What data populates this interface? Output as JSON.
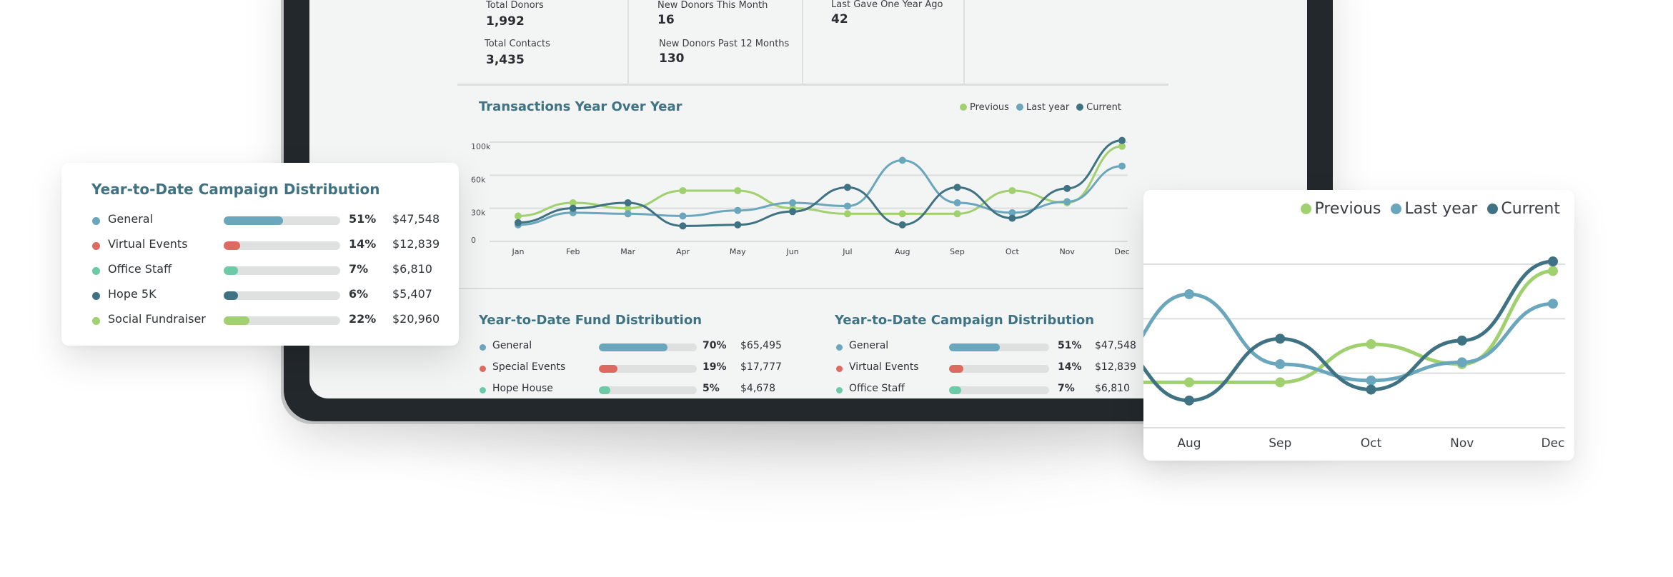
{
  "stats": {
    "total_donors": {
      "label": "Total Donors",
      "value": "1,992"
    },
    "total_contacts": {
      "label": "Total Contacts",
      "value": "3,435"
    },
    "new_donors_month": {
      "label": "New Donors This Month",
      "value": "16"
    },
    "new_donors_12m": {
      "label": "New Donors Past 12 Months",
      "value": "130"
    },
    "last_gave_one_year": {
      "label": "Last Gave One Year Ago",
      "value": "42"
    }
  },
  "colors": {
    "previous": "#a0d16e",
    "last_year": "#6aa6bc",
    "current": "#3f7282",
    "title": "#3f7384",
    "general": "#6aa6bc",
    "events": "#dc6a60",
    "office": "#6ccaa6",
    "hope5k": "#3f7282",
    "social": "#a0d16e"
  },
  "chart_data": [
    {
      "type": "line",
      "title": "Transactions Year Over Year",
      "xlabel": "",
      "ylabel": "",
      "y_ticks": [
        "0",
        "30k",
        "60k",
        "100k"
      ],
      "y_tick_values": [
        0,
        30,
        60,
        100
      ],
      "y_unit": "k",
      "grid": true,
      "legend": "top-right",
      "categories": [
        "Jan",
        "Feb",
        "Mar",
        "Apr",
        "May",
        "Jun",
        "Jul",
        "Aug",
        "Sep",
        "Oct",
        "Nov",
        "Dec"
      ],
      "series": [
        {
          "name": "Previous",
          "key": "previous",
          "values": [
            23,
            35,
            30,
            46,
            46,
            30,
            25,
            25,
            25,
            46,
            35,
            95
          ]
        },
        {
          "name": "Last year",
          "key": "last_year",
          "values": [
            15,
            26,
            25,
            23,
            28,
            35,
            32,
            78,
            35,
            26,
            36,
            71
          ]
        },
        {
          "name": "Current",
          "key": "current",
          "values": [
            17,
            30,
            35,
            14,
            15,
            27,
            49,
            15,
            49,
            21,
            48,
            102
          ]
        }
      ]
    },
    {
      "type": "line",
      "title": "",
      "xlabel": "",
      "ylabel": "",
      "grid": true,
      "legend": "top-right",
      "y_tick_values": [
        0,
        30,
        60,
        100
      ],
      "categories": [
        "Aug",
        "Sep",
        "Oct",
        "Nov",
        "Dec"
      ],
      "series": [
        {
          "name": "Previous",
          "key": "previous",
          "values": [
            25,
            25,
            46,
            35,
            95
          ]
        },
        {
          "name": "Last year",
          "key": "last_year",
          "values": [
            78,
            35,
            26,
            36,
            71
          ]
        },
        {
          "name": "Current",
          "key": "current",
          "values": [
            15,
            49,
            21,
            48,
            102
          ]
        }
      ]
    }
  ],
  "fund_distribution": {
    "title": "Year-to-Date Fund Distribution",
    "rows": [
      {
        "label": "General",
        "percent": 70,
        "percent_label": "70%",
        "amount": "$65,495",
        "color": "#6aa6bc"
      },
      {
        "label": "Special Events",
        "percent": 19,
        "percent_label": "19%",
        "amount": "$17,777",
        "color": "#dc6a60"
      },
      {
        "label": "Hope House",
        "percent": 5,
        "percent_label": "5%",
        "amount": "$4,678",
        "color": "#6ccaa6"
      }
    ]
  },
  "campaign_distribution": {
    "title": "Year-to-Date Campaign Distribution",
    "rows": [
      {
        "label": "General",
        "percent": 51,
        "percent_label": "51%",
        "amount": "$47,548",
        "color": "#6aa6bc"
      },
      {
        "label": "Virtual Events",
        "percent": 14,
        "percent_label": "14%",
        "amount": "$12,839",
        "color": "#dc6a60"
      },
      {
        "label": "Office Staff",
        "percent": 7,
        "percent_label": "7%",
        "amount": "$6,810",
        "color": "#6ccaa6"
      },
      {
        "label": "Hope 5K",
        "percent": 6,
        "percent_label": "6%",
        "amount": "$5,407",
        "color": "#3f7282"
      },
      {
        "label": "Social Fundraiser",
        "percent": 22,
        "percent_label": "22%",
        "amount": "$20,960",
        "color": "#a0d16e"
      }
    ]
  }
}
